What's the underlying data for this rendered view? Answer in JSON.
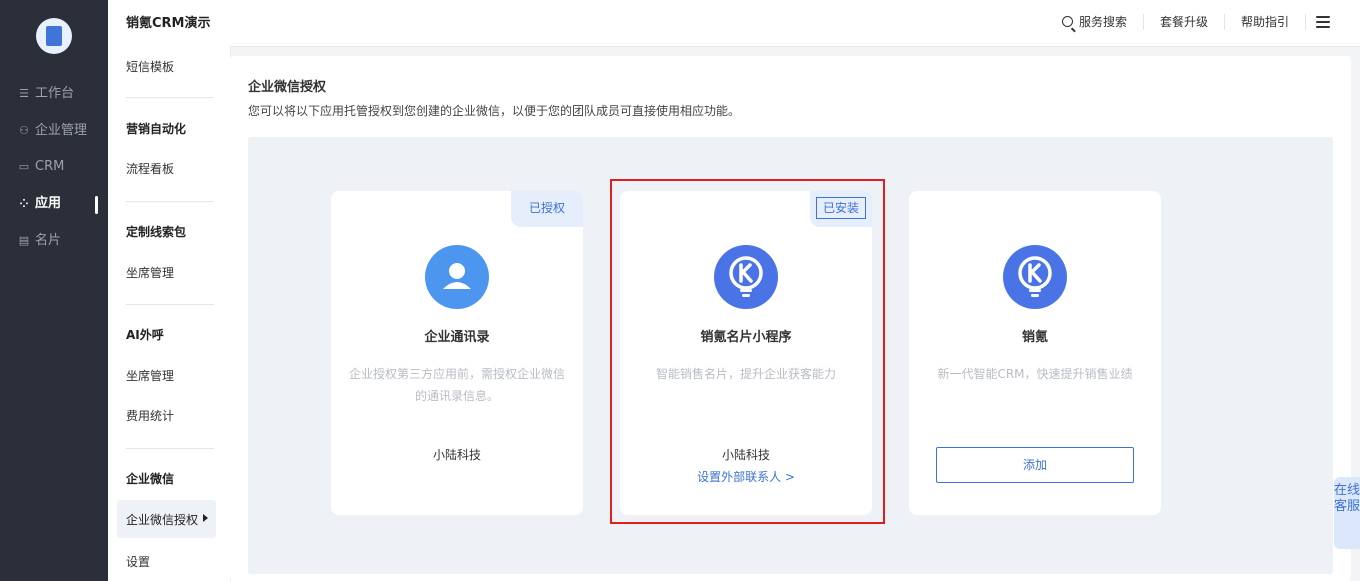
{
  "nav": {
    "items": [
      {
        "label": "工作台",
        "icon": "workbench-icon",
        "glyph": "☰"
      },
      {
        "label": "企业管理",
        "icon": "org-icon",
        "glyph": "⚇"
      },
      {
        "label": "CRM",
        "icon": "crm-icon",
        "glyph": "▭"
      },
      {
        "label": "应用",
        "icon": "apps-icon",
        "glyph": "⁘"
      },
      {
        "label": "名片",
        "icon": "card-icon",
        "glyph": "▤"
      }
    ]
  },
  "topbar": {
    "brand": "销氪CRM演示",
    "search": "服务搜索",
    "upgrade": "套餐升级",
    "help": "帮助指引"
  },
  "subnav": {
    "sms_template": "短信模板",
    "group_marketing": "营销自动化",
    "flow_board": "流程看板",
    "group_leads": "定制线索包",
    "seat_mgmt_1": "坐席管理",
    "group_ai": "AI外呼",
    "seat_mgmt_2": "坐席管理",
    "cost_stats": "费用统计",
    "group_wecom": "企业微信",
    "wecom_auth": "企业微信授权",
    "settings": "设置"
  },
  "panel": {
    "title": "企业微信授权",
    "desc": "您可以将以下应用托管授权到您创建的企业微信，以便于您的团队成员可直接使用相应功能。"
  },
  "cards": [
    {
      "badge": "已授权",
      "name": "企业通讯录",
      "desc": "企业授权第三方应用前，需授权企业微信的通讯录信息。",
      "vendor": "小陆科技",
      "logo_color": "#4d96f0"
    },
    {
      "badge": "已安装",
      "name": "销氪名片小程序",
      "desc": "智能销售名片，提升企业获客能力",
      "vendor": "小陆科技",
      "link": "设置外部联系人 >",
      "logo_color": "#4a74e6"
    },
    {
      "name": "销氪",
      "desc": "新一代智能CRM，快速提升销售业绩",
      "button": "添加",
      "logo_color": "#4a74e6"
    }
  ],
  "float_service": "在线客服",
  "colors": {
    "accent": "#3d72d6",
    "highlight": "#e02020",
    "sidebar": "#2b2f3a"
  }
}
